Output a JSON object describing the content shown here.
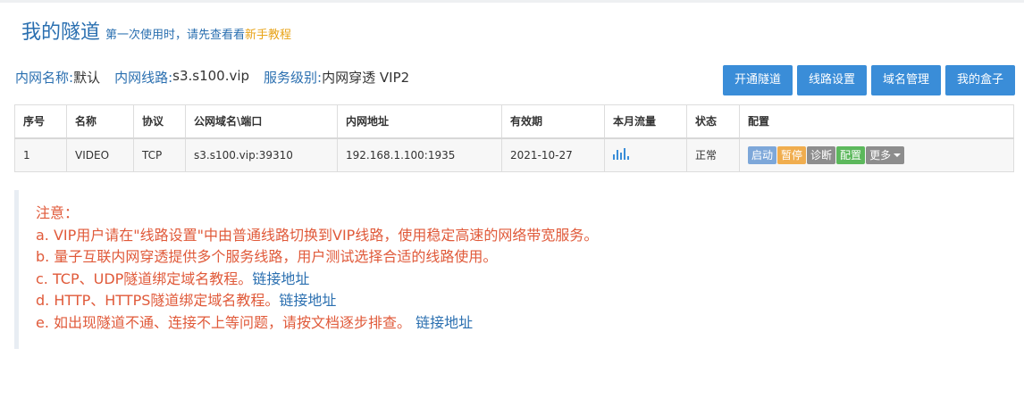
{
  "header": {
    "title": "我的隧道",
    "subtitle": "第一次使用时，请先查看看",
    "subtitle_link": "新手教程"
  },
  "info": {
    "name_label": "内网名称:",
    "name_value": "默认",
    "line_label": "内网线路:",
    "line_value": "s3.s100.vip",
    "level_label": "服务级别:",
    "level_value": "内网穿透 VIP2"
  },
  "actions": {
    "open_tunnel": "开通隧道",
    "line_settings": "线路设置",
    "domain_manage": "域名管理",
    "my_box": "我的盒子"
  },
  "table": {
    "headers": [
      "序号",
      "名称",
      "协议",
      "公网域名\\端口",
      "内网地址",
      "有效期",
      "本月流量",
      "状态",
      "配置"
    ],
    "rows": [
      {
        "index": "1",
        "name": "VIDEO",
        "protocol": "TCP",
        "public": "s3.s100.vip:39310",
        "internal": "192.168.1.100:1935",
        "expiry": "2021-10-27",
        "status": "正常"
      }
    ],
    "row_actions": {
      "start": "启动",
      "pause": "暂停",
      "diagnose": "诊断",
      "config": "配置",
      "more": "更多"
    }
  },
  "notice": {
    "title": "注意：",
    "a": "a. VIP用户请在\"线路设置\"中由普通线路切换到VIP线路，使用稳定高速的网络带宽服务。",
    "b": "b. 量子互联内网穿透提供多个服务线路，用户测试选择合适的线路使用。",
    "c": "c. TCP、UDP隧道绑定域名教程。",
    "c_link": "链接地址",
    "d": "d. HTTP、HTTPS隧道绑定域名教程。",
    "d_link": "链接地址",
    "e": "e. 如出现隧道不通、连接不上等问题，请按文档逐步排查。",
    "e_link": "链接地址"
  },
  "icons": {
    "traffic": "bar-chart-icon",
    "more_caret": "caret-down-icon"
  },
  "colors": {
    "primary": "#3a8dd8",
    "title_blue": "#2a6fb0",
    "notice_red": "#e05a3a",
    "link_orange": "#e8a317",
    "pause": "#f0ad4e",
    "config": "#5cb85c",
    "neutral": "#8d8d8d"
  }
}
